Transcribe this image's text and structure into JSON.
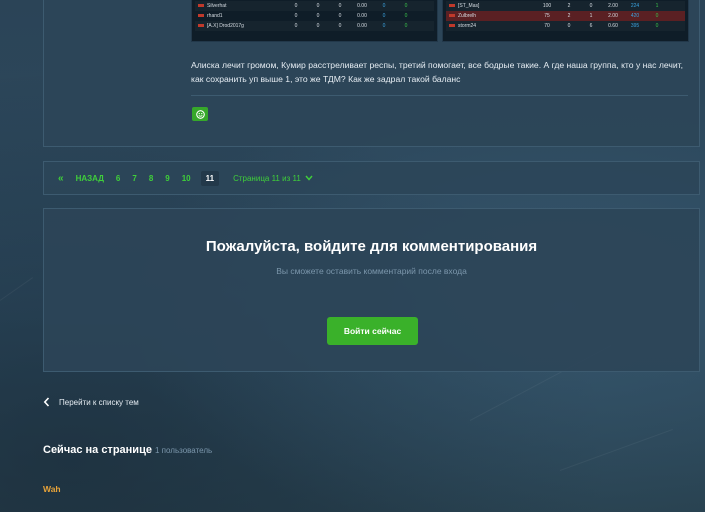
{
  "scoreboards": {
    "left": [
      {
        "name": "Silverhat",
        "cells": [
          "",
          "0",
          "0",
          "0",
          "0.00",
          "0",
          "0"
        ]
      },
      {
        "name": "rhand1",
        "cells": [
          "",
          "0",
          "0",
          "0",
          "0.00",
          "0",
          "0"
        ]
      },
      {
        "name": "[A.X] Drod2017g",
        "cells": [
          "",
          "0",
          "0",
          "0",
          "0.00",
          "0",
          "0"
        ]
      }
    ],
    "right": [
      {
        "name": "[ST_Mas]",
        "cells": [
          "",
          "100",
          "2",
          "0",
          "2.00",
          "224",
          "1"
        ]
      },
      {
        "name": "Zulbrelh",
        "cells": [
          "",
          "75",
          "2",
          "1",
          "2.00",
          "420",
          "0"
        ]
      },
      {
        "name": "storm24",
        "cells": [
          "",
          "70",
          "0",
          "6",
          "0.60",
          "395",
          "0"
        ]
      }
    ]
  },
  "post": {
    "text": "Алиска лечит громом, Кумир расстреливает респы, третий помогает, все бодрые такие.  А где наша группа, кто у нас лечит, как сохранить уп выше 1, это же ТДМ?  Как же задрал такой баланс"
  },
  "pagination": {
    "prev_arrow": "«",
    "prev_label": "НАЗАД",
    "pages": [
      "6",
      "7",
      "8",
      "9",
      "10"
    ],
    "current": "11",
    "page_of": "Страница 11 из 11"
  },
  "login": {
    "title": "Пожалуйста, войдите для комментирования",
    "subtitle": "Вы сможете оставить комментарий после входа",
    "button": "Войти сейчас"
  },
  "back": {
    "label": "Перейти к списку тем"
  },
  "online": {
    "title": "Сейчас на странице",
    "count": "1 пользователь",
    "users": [
      "Wah"
    ]
  },
  "colors": {
    "accent_green": "#3ab12a",
    "link_green": "#3fcf3a",
    "user_orange": "#e6a33a",
    "panel_bg": "#2c4558"
  },
  "icons": {
    "reaction": "smile-icon",
    "page_dropdown": "chevron-down-icon",
    "back": "chevron-left-icon"
  }
}
